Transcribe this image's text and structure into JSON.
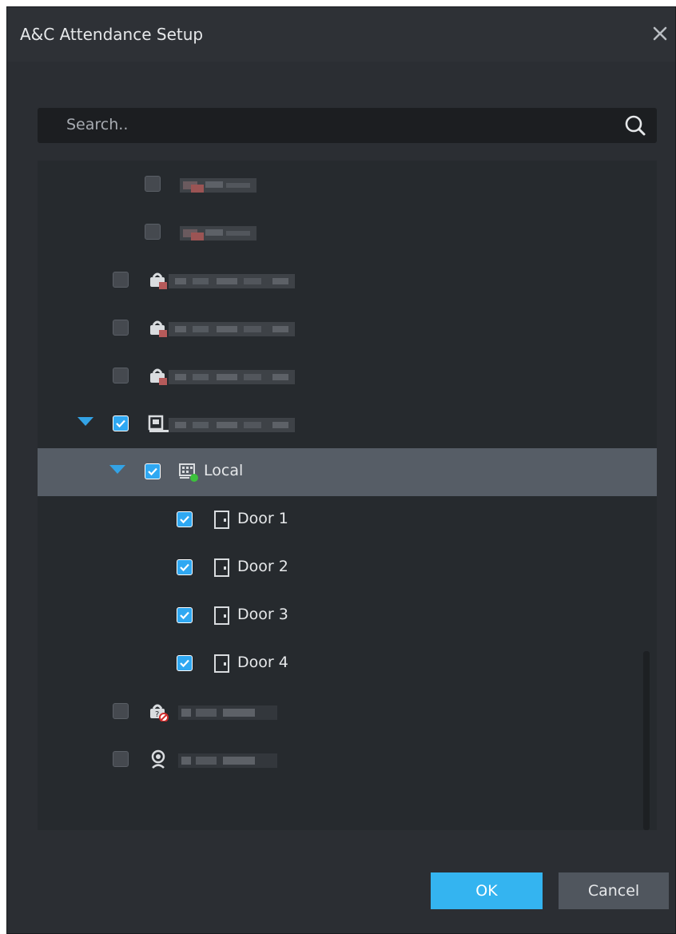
{
  "dialog": {
    "title": "A&C Attendance Setup"
  },
  "search": {
    "placeholder": "Search.."
  },
  "tree": {
    "local": {
      "label": "Local",
      "checked": true,
      "expanded": true,
      "icon": "access-controller-icon"
    },
    "doors": [
      {
        "label": "Door 1",
        "checked": true,
        "icon": "door-icon"
      },
      {
        "label": "Door 2",
        "checked": true,
        "icon": "door-icon"
      },
      {
        "label": "Door 3",
        "checked": true,
        "icon": "door-icon"
      },
      {
        "label": "Door 4",
        "checked": true,
        "icon": "door-icon"
      }
    ]
  },
  "buttons": {
    "ok": "OK",
    "cancel": "Cancel"
  },
  "colors": {
    "accent": "#2fa8f2",
    "dialog_bg": "#2b2e33",
    "selected_row": "#565d66"
  }
}
